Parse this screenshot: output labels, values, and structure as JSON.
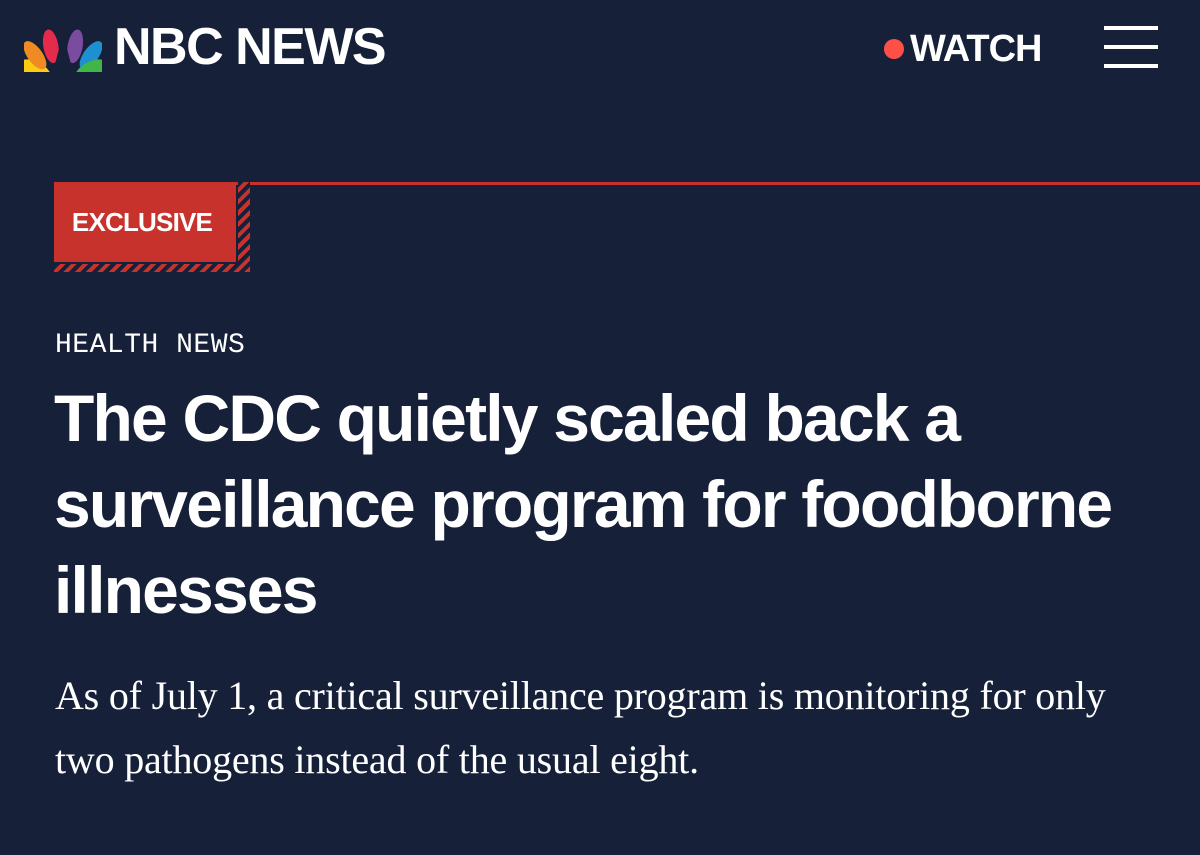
{
  "header": {
    "brand_name": "NBC NEWS",
    "logo_icon": "peacock-icon",
    "watch_label": "WATCH",
    "watch_dot_color": "#ff5047",
    "menu_icon": "hamburger-menu-icon"
  },
  "article": {
    "badge_label": "EXCLUSIVE",
    "section": "HEALTH NEWS",
    "headline": "The CDC quietly scaled back a surveillance program for foodborne illnesses",
    "dek": "As of July 1, a critical surveillance program is monitoring for only two pathogens instead of the usual eight."
  },
  "colors": {
    "background": "#162139",
    "accent_red": "#c8322c",
    "text": "#ffffff"
  }
}
